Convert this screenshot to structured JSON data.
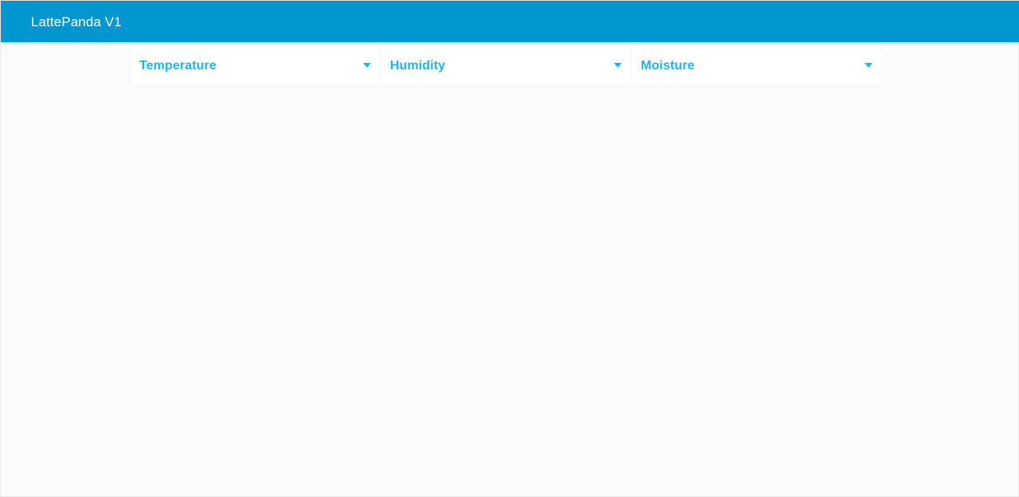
{
  "app": {
    "title": "LattePanda V1",
    "brand_color": "#0096d1",
    "accent_color": "#1fb3ea",
    "background_color": "#fafafa"
  },
  "panels": [
    {
      "label": "Temperature",
      "icon": "chevron-down-icon"
    },
    {
      "label": "Humidity",
      "icon": "chevron-down-icon"
    },
    {
      "label": "Moisture",
      "icon": "chevron-down-icon"
    }
  ]
}
